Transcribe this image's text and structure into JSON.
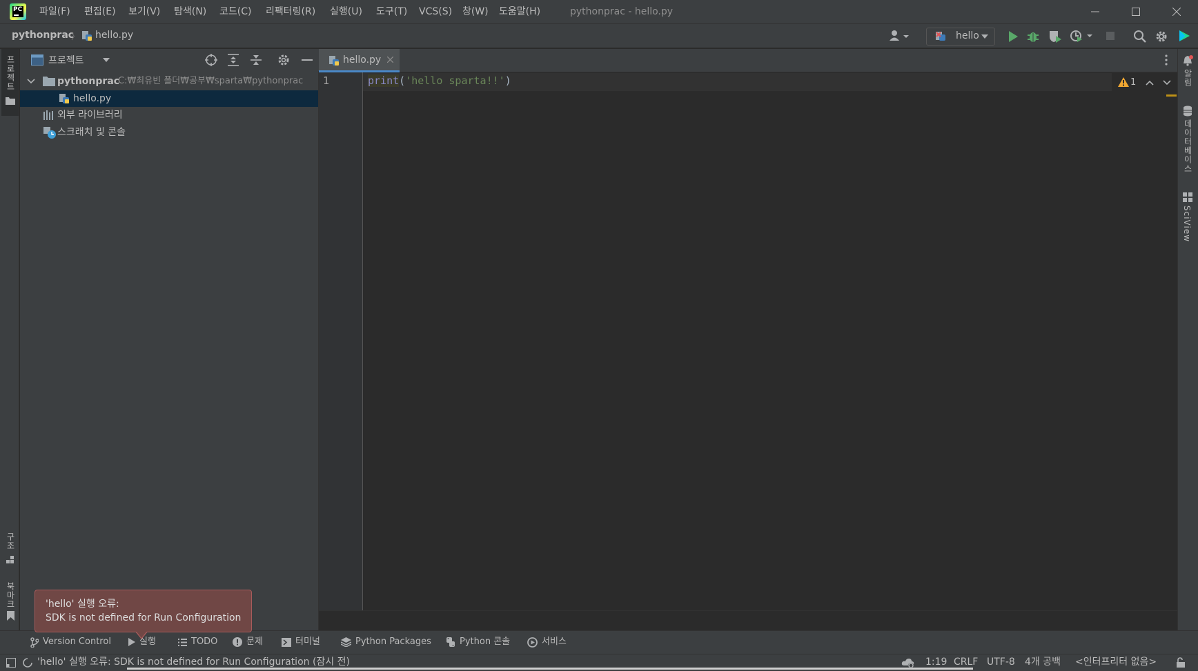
{
  "window": {
    "title": "pythonprac - hello.py",
    "menu": [
      "파일(F)",
      "편집(E)",
      "보기(V)",
      "탐색(N)",
      "코드(C)",
      "리팩터링(R)",
      "실행(U)",
      "도구(T)",
      "VCS(S)",
      "창(W)",
      "도움말(H)"
    ]
  },
  "navbar": {
    "project": "pythonprac",
    "file": "hello.py",
    "run_config": "hello"
  },
  "left_stripe": {
    "project": "프로젝트",
    "structure": "구조",
    "bookmarks": "북마크"
  },
  "project_panel": {
    "title": "프로젝트",
    "root_name": "pythonprac",
    "root_path": "C:₩최유빈 폴더₩공부₩sparta₩pythonprac",
    "file": "hello.py",
    "external_libs": "외부 라이브러리",
    "scratches": "스크래치 및 콘솔"
  },
  "editor": {
    "tab": "hello.py",
    "line_number": "1",
    "code": {
      "fn": "print",
      "open": "(",
      "string": "'hello sparta!!'",
      "close": ")"
    },
    "warnings": "1"
  },
  "right_stripe": {
    "notifications": "알림",
    "database": "데이터베이스",
    "sciview": "SciView"
  },
  "tool_tabs": [
    "Version Control",
    "실행",
    "TODO",
    "문제",
    "터미널",
    "Python Packages",
    "Python 콘솔",
    "서비스"
  ],
  "status": {
    "message": "'hello' 실행 오류: SDK is not defined for Run Configuration (잠시 전)",
    "position": "1:19",
    "line_sep": "CRLF",
    "encoding": "UTF-8",
    "indent": "4개 공백",
    "interpreter": "<인터프리터 없음>"
  },
  "balloon": {
    "title": "'hello' 실행 오류:",
    "body": "SDK is not defined for Run Configuration"
  },
  "colors": {
    "accent": "#4a88c7",
    "run_green": "#59a869",
    "error_balloon": "#704745",
    "warning": "#f0a732"
  }
}
